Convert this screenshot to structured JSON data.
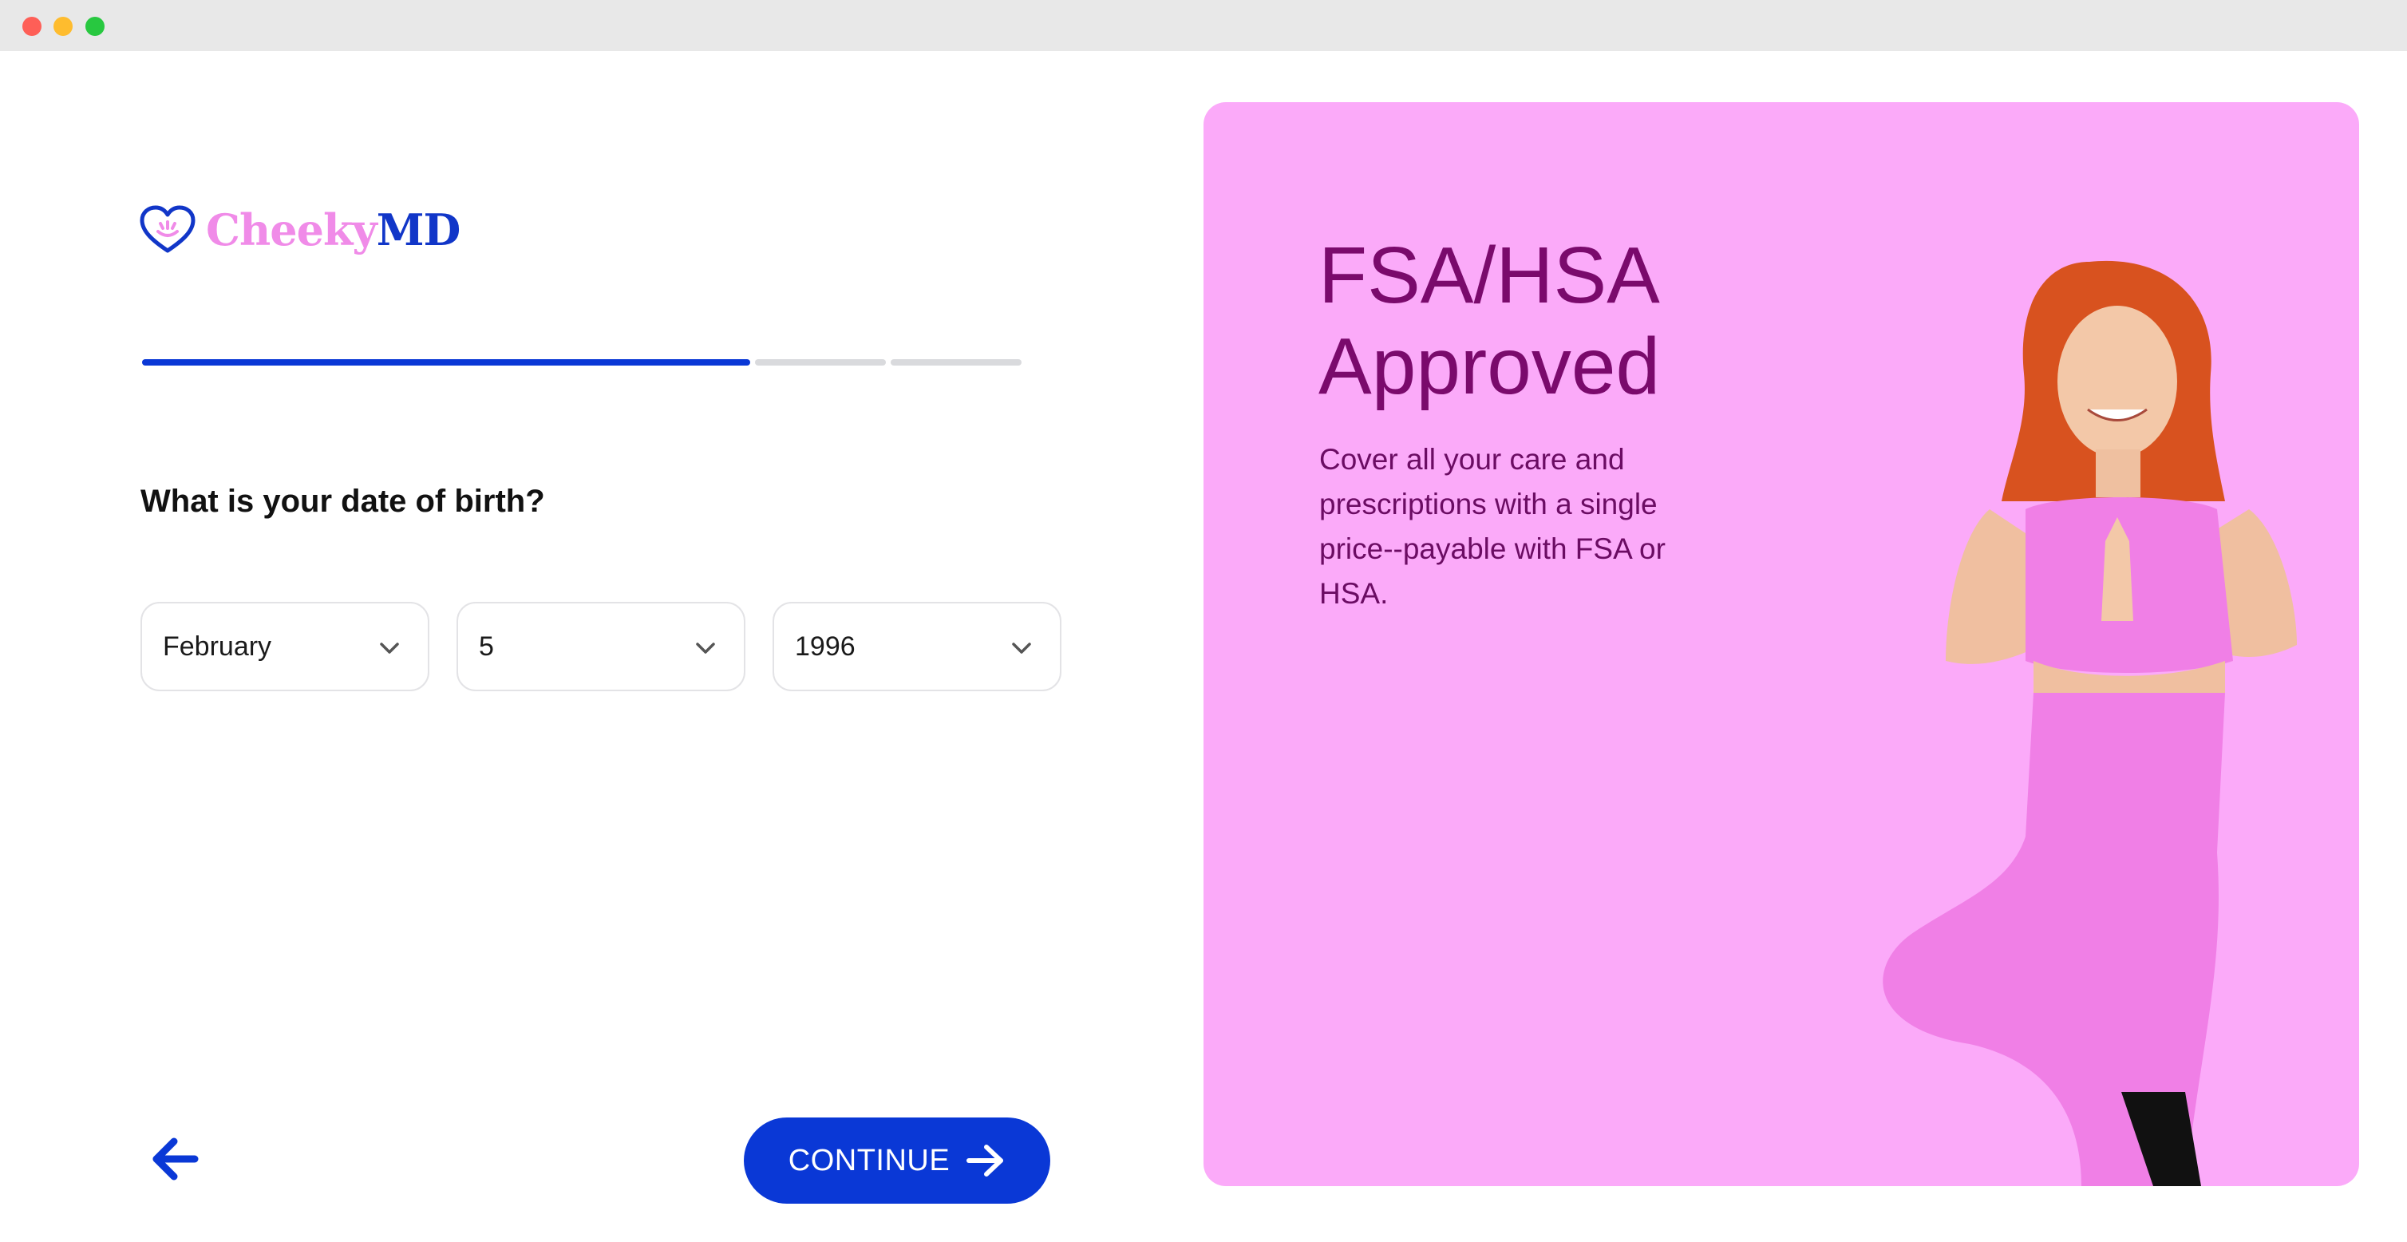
{
  "brand": {
    "name_part1": "Cheeky",
    "name_part2": "MD"
  },
  "progress": {
    "completed_steps": 1,
    "total_steps": 3,
    "fraction": 0.63
  },
  "form": {
    "question": "What is your date of birth?",
    "month": {
      "value": "February"
    },
    "day": {
      "value": "5"
    },
    "year": {
      "value": "1996"
    }
  },
  "nav": {
    "continue_label": "CONTINUE"
  },
  "promo": {
    "title_line1": "FSA/HSA",
    "title_line2": "Approved",
    "body": "Cover all your care and prescriptions with a single price--payable with FSA or HSA."
  },
  "colors": {
    "accent": "#0a38d6",
    "brand_pink": "#f08be8",
    "promo_bg": "#fbaaf9",
    "promo_text": "#7a0a6c"
  }
}
